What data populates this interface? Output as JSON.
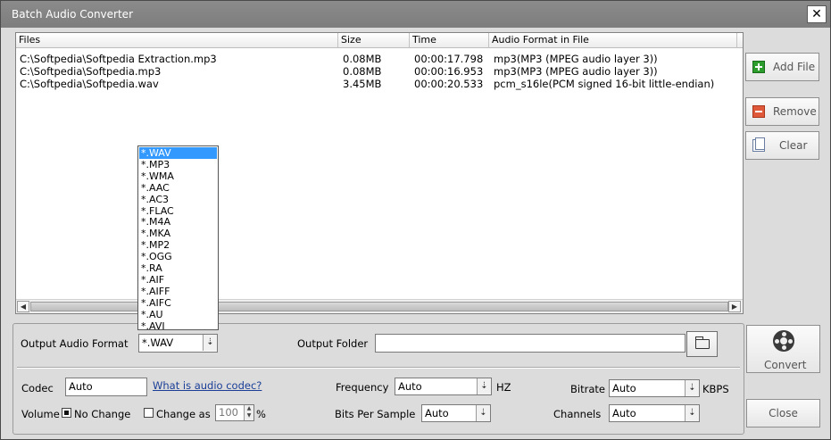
{
  "window": {
    "title": "Batch Audio Converter",
    "close_glyph": "✕"
  },
  "files": {
    "columns": [
      "Files",
      "Size",
      "Time",
      "Audio Format in File"
    ],
    "rows": [
      [
        "C:\\Softpedia\\Softpedia Extraction.mp3",
        "0.08MB",
        "00:00:17.798",
        "mp3(MP3 (MPEG audio layer 3))"
      ],
      [
        "C:\\Softpedia\\Softpedia.mp3",
        "0.08MB",
        "00:00:16.953",
        "mp3(MP3 (MPEG audio layer 3))"
      ],
      [
        "C:\\Softpedia\\Softpedia.wav",
        "3.45MB",
        "00:00:20.533",
        "pcm_s16le(PCM signed 16-bit little-endian)"
      ]
    ]
  },
  "side": {
    "add": "Add File",
    "remove": "Remove",
    "clear": "Clear",
    "convert": "Convert",
    "close": "Close"
  },
  "settings": {
    "output_format_label": "Output Audio Format",
    "output_format_value": "*.WAV",
    "output_folder_label": "Output Folder",
    "output_folder_value": "",
    "codec_label": "Codec",
    "codec_value": "Auto",
    "codec_link": "What is audio codec?",
    "frequency_label": "Frequency",
    "frequency_value": "Auto",
    "frequency_unit": "HZ",
    "bitrate_label": "Bitrate",
    "bitrate_value": "Auto",
    "bitrate_unit": "KBPS",
    "volume_label": "Volume",
    "no_change_label": "No Change",
    "change_as_label": "Change as",
    "change_as_value": "100",
    "percent": "%",
    "bps_label": "Bits Per Sample",
    "bps_value": "Auto",
    "channels_label": "Channels",
    "channels_value": "Auto"
  },
  "format_options": [
    "*.WAV",
    "*.MP3",
    "*.WMA",
    "*.AAC",
    "*.AC3",
    "*.FLAC",
    "*.M4A",
    "*.MKA",
    "*.MP2",
    "*.OGG",
    "*.RA",
    "*.AIF",
    "*.AIFF",
    "*.AIFC",
    "*.AU",
    "*.AVI"
  ],
  "format_selected": "*.WAV"
}
